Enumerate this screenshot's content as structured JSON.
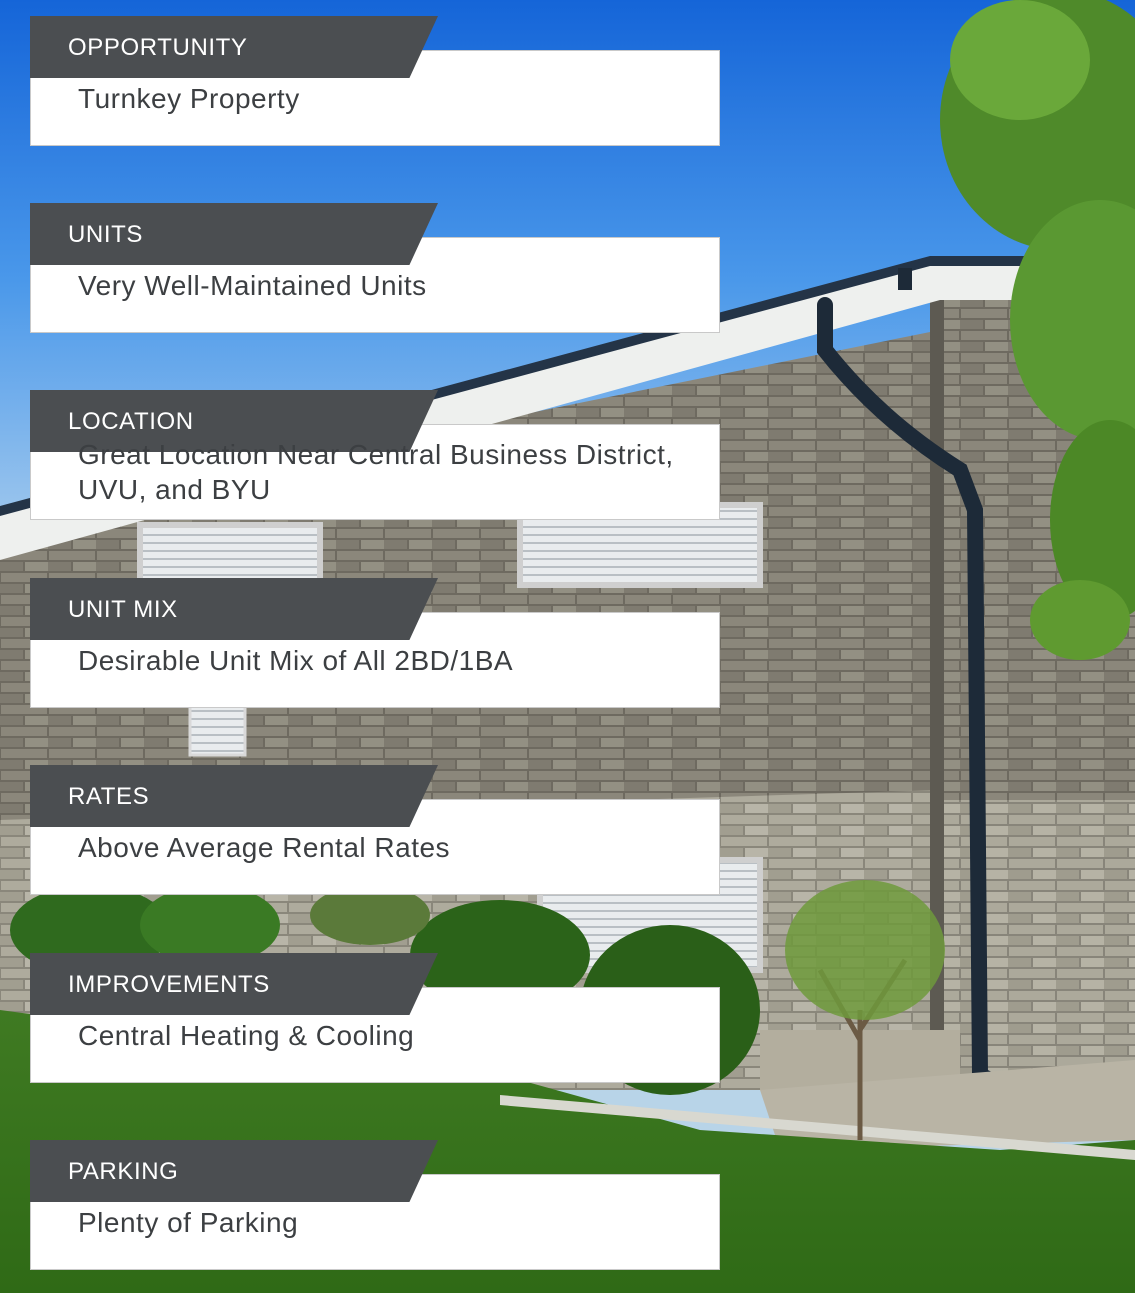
{
  "features": [
    {
      "label": "OPPORTUNITY",
      "value": "Turnkey Property"
    },
    {
      "label": "UNITS",
      "value": "Very Well-Maintained Units"
    },
    {
      "label": "LOCATION",
      "value": "Great Location Near Central Business District, UVU, and BYU"
    },
    {
      "label": "UNIT MIX",
      "value": "Desirable Unit Mix of All 2BD/1BA"
    },
    {
      "label": "RATES",
      "value": "Above Average Rental Rates"
    },
    {
      "label": "IMPROVEMENTS",
      "value": "Central Heating & Cooling"
    },
    {
      "label": "PARKING",
      "value": "Plenty of Parking"
    }
  ],
  "colors": {
    "tag_background": "#4b4e51",
    "card_background": "#ffffff",
    "value_text": "#3c3f42"
  }
}
